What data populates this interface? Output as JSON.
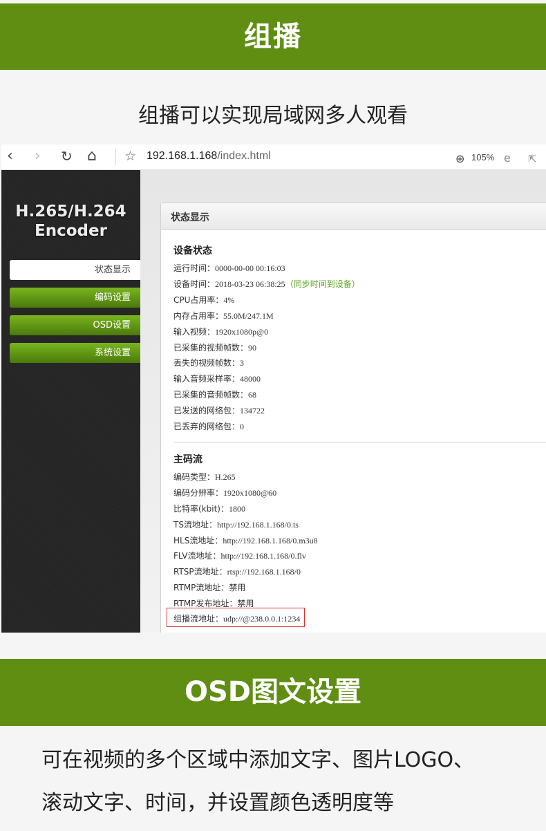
{
  "top_banner": {
    "title": "组播",
    "subtitle": "组播可以实现局域网多人观看"
  },
  "browser": {
    "url_host": "192.168.1.168",
    "url_path": "/index.html",
    "zoom": "105%",
    "icons": [
      "back-icon",
      "forward-icon",
      "refresh-icon",
      "home-icon",
      "favorite-star-icon",
      "zoom-icon",
      "ie-mode-icon",
      "share-icon"
    ]
  },
  "sidebar": {
    "logo_line1": "H.265/H.264",
    "logo_line2": "Encoder",
    "items": [
      {
        "label": "状态显示",
        "active": true
      },
      {
        "label": "编码设置",
        "active": false
      },
      {
        "label": "OSD设置",
        "active": false
      },
      {
        "label": "系统设置",
        "active": false
      }
    ]
  },
  "panel": {
    "title": "状态显示",
    "device_status": {
      "title": "设备状态",
      "run_time": {
        "label": "运行时间：",
        "value": "0000-00-00 00:16:03"
      },
      "device_time": {
        "label": "设备时间：",
        "value": "2018-03-23 06:38:25",
        "sync_link": "（同步时间到设备）"
      },
      "cpu": {
        "label": "CPU占用率：",
        "value": "4%"
      },
      "memory": {
        "label": "内存占用率：",
        "value": "55.0M/247.1M"
      },
      "input_video": {
        "label": "输入视频：",
        "value": "1920x1080p@0"
      },
      "captured_frames": {
        "label": "已采集的视频帧数：",
        "value": "90"
      },
      "lost_frames": {
        "label": "丢失的视频帧数：",
        "value": "3"
      },
      "audio_rate": {
        "label": "输入音频采样率：",
        "value": "48000"
      },
      "audio_frames": {
        "label": "已采集的音频帧数：",
        "value": "68"
      },
      "packets_sent": {
        "label": "已发送的网络包：",
        "value": "134722"
      },
      "packets_dropped": {
        "label": "已丢弃的网络包：",
        "value": "0"
      }
    },
    "main_stream": {
      "title": "主码流",
      "codec": {
        "label": "编码类型：",
        "value": "H.265"
      },
      "resolution": {
        "label": "编码分辨率：",
        "value": "1920x1080@60"
      },
      "bitrate": {
        "label": "比特率(kbit)：",
        "value": "1800"
      },
      "ts_url": {
        "label": "TS流地址：",
        "value": "http://192.168.1.168/0.ts"
      },
      "hls_url": {
        "label": "HLS流地址：",
        "value": "http://192.168.1.168/0.m3u8"
      },
      "flv_url": {
        "label": "FLV流地址：",
        "value": "http://192.168.1.168/0.flv"
      },
      "rtsp_url": {
        "label": "RTSP流地址：",
        "value": "rtsp://192.168.1.168/0"
      },
      "rtmp_url": {
        "label": "RTMP流地址：",
        "value": "禁用"
      },
      "rtmp_publish": {
        "label": "RTMP发布地址：",
        "value": "禁用"
      },
      "multicast_url": {
        "label": "组播流地址：",
        "value": "udp://@238.0.0.1:1234"
      }
    }
  },
  "bottom_banner": {
    "title": "OSD图文设置",
    "desc_line1": "可在视频的多个区域中添加文字、图片LOGO、",
    "desc_line2": "滚动文字、时间，并设置颜色透明度等"
  },
  "colors": {
    "brand_green": "#5f8e13",
    "highlight_red": "#d9302c",
    "sync_green": "#5aa01e"
  }
}
